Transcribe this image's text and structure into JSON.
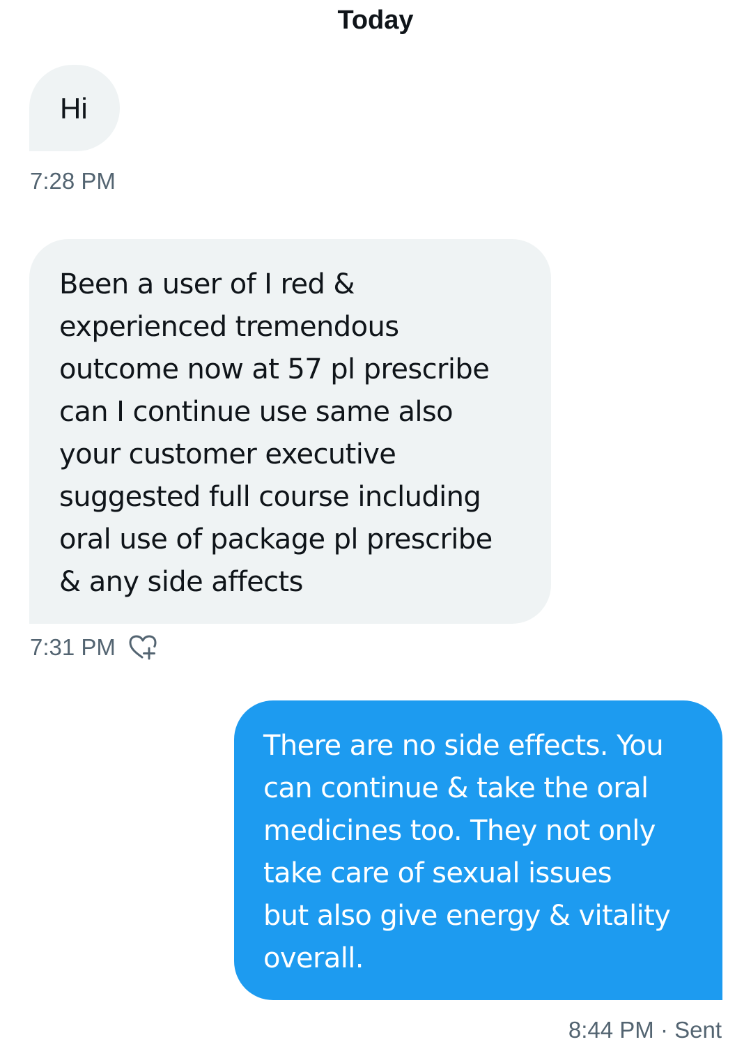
{
  "conversation": {
    "date_header": "Today"
  },
  "messages": [
    {
      "direction": "received",
      "text": "Hi",
      "time": "7:28 PM"
    },
    {
      "direction": "received",
      "text": "Been a user of I red &\nexperienced tremendous\noutcome now at 57 pl prescribe\ncan I continue use same also\nyour customer executive\nsuggested full course including\noral use of package pl prescribe\n& any side affects",
      "time": "7:31 PM",
      "reaction_icon": "add-reaction-heart-icon"
    },
    {
      "direction": "sent",
      "text": "There are no side effects. You\ncan continue & take the oral\nmedicines too. They not only\ntake care of sexual issues\nbut also give energy & vitality\noverall.",
      "time": "8:44 PM · Sent"
    }
  ],
  "colors": {
    "received_bubble": "#eff3f4",
    "sent_bubble": "#1d9bf0",
    "meta_text": "#536471",
    "primary_text": "#0f1419"
  }
}
